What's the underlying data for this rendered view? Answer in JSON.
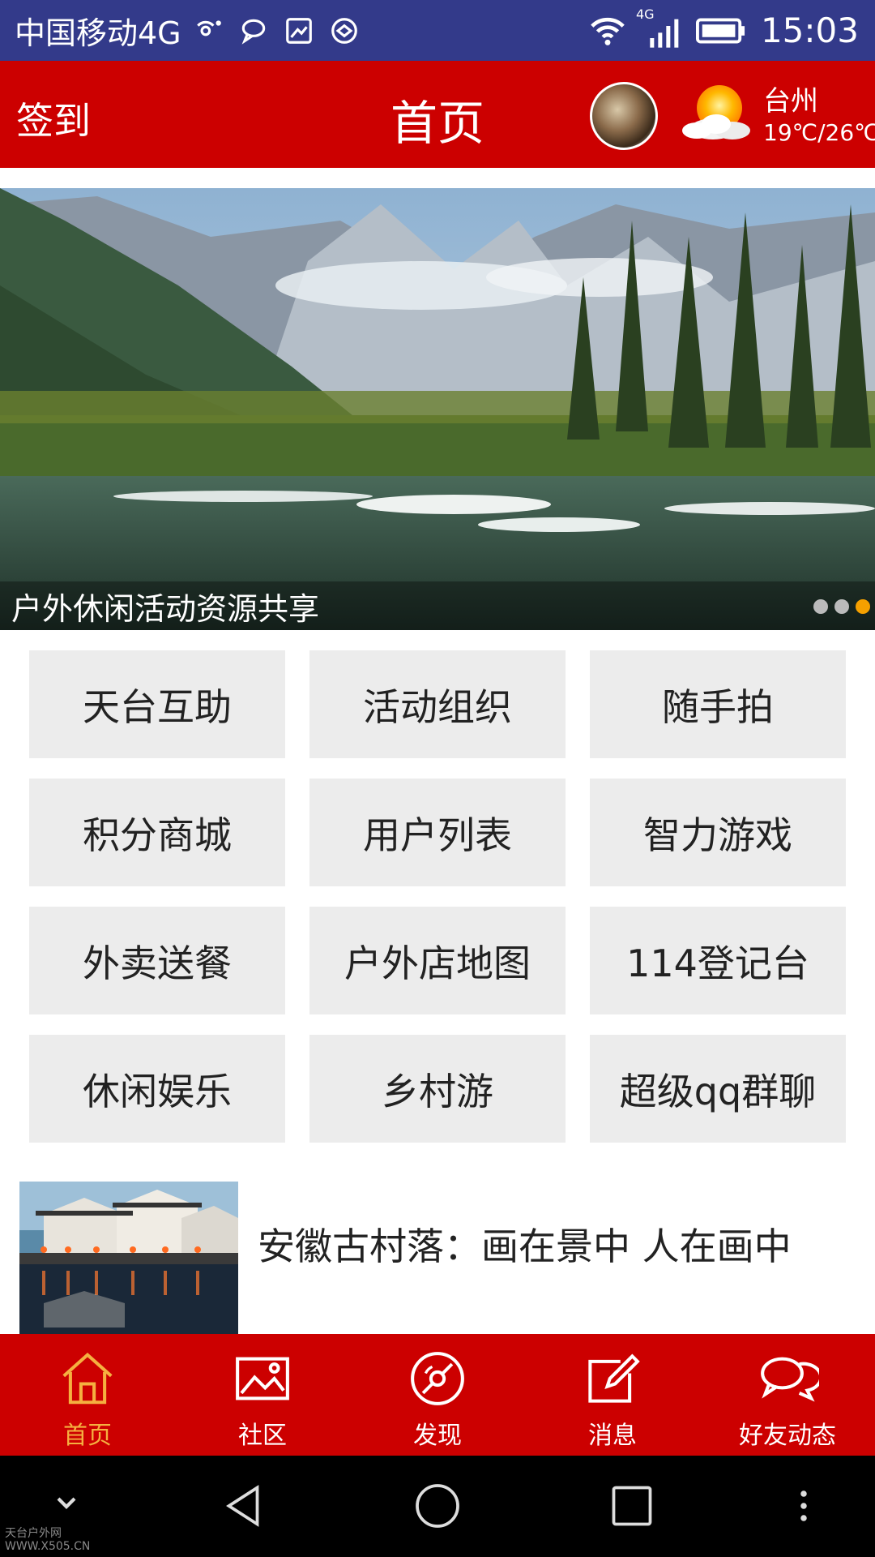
{
  "status_bar": {
    "carrier": "中国移动4G",
    "network_badge": "4G",
    "time": "15:03"
  },
  "header": {
    "sign_in": "签到",
    "title": "首页",
    "weather": {
      "city": "台州",
      "temp": "19℃/26℃"
    }
  },
  "banner": {
    "caption": "户外休闲活动资源共享",
    "slide_count": 3,
    "active_slide": 3
  },
  "grid": [
    "天台互助",
    "活动组织",
    "随手拍",
    "积分商城",
    "用户列表",
    "智力游戏",
    "外卖送餐",
    "户外店地图",
    "114登记台",
    "休闲娱乐",
    "乡村游",
    "超级qq群聊"
  ],
  "news": {
    "title": "安徽古村落：画在景中 人在画中"
  },
  "bottom_nav": [
    {
      "label": "首页",
      "icon": "home-icon",
      "active": true
    },
    {
      "label": "社区",
      "icon": "image-icon",
      "active": false
    },
    {
      "label": "发现",
      "icon": "compass-icon",
      "active": false
    },
    {
      "label": "消息",
      "icon": "edit-icon",
      "active": false
    },
    {
      "label": "好友动态",
      "icon": "chat-icon",
      "active": false
    }
  ],
  "watermark": {
    "line1": "天台户外网",
    "line2": "WWW.X505.CN"
  },
  "colors": {
    "brand_red": "#cc0000",
    "status_bar": "#333a8a",
    "active_nav": "#f5b040",
    "active_dot": "#f5a000"
  }
}
